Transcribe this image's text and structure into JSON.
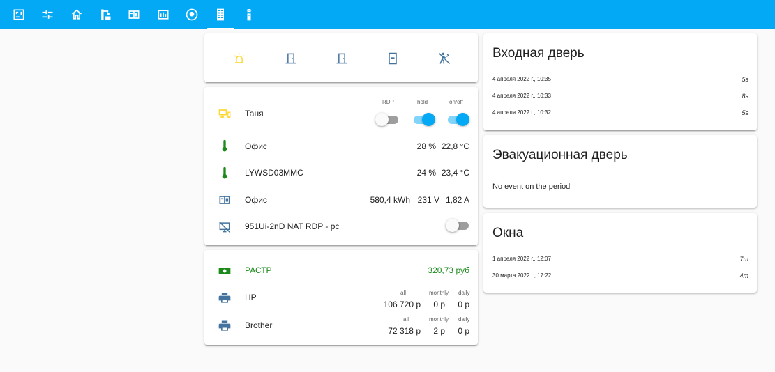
{
  "topbar": {
    "tabs": [
      {
        "icon": "floorplan-icon"
      },
      {
        "icon": "sliders-icon"
      },
      {
        "icon": "home-icon"
      },
      {
        "icon": "crane-icon"
      },
      {
        "icon": "meter-icon"
      },
      {
        "icon": "dashboard-icon"
      },
      {
        "icon": "robot-vacuum-icon"
      },
      {
        "icon": "office-building-icon"
      },
      {
        "icon": "remote-icon"
      }
    ],
    "active_tab": 7
  },
  "colors": {
    "accent": "#03a9f4",
    "icon_blue": "#44739e",
    "warning_yellow": "#fdd835",
    "green": "#1b8a1b",
    "text": "#212121"
  },
  "quick_icons": [
    {
      "icon": "alarm-light-icon",
      "color": "#fdd835"
    },
    {
      "icon": "door-icon",
      "color": "#44739e"
    },
    {
      "icon": "door-icon",
      "color": "#44739e"
    },
    {
      "icon": "door-sensor-icon",
      "color": "#44739e"
    },
    {
      "icon": "motion-sensor-icon",
      "color": "#44739e"
    }
  ],
  "office": {
    "switch_headers": {
      "rdp": "RDP",
      "hold": "hold",
      "onoff": "on/off"
    },
    "tanya": {
      "name": "Таня",
      "icon": "monitor-cellphone-icon",
      "rdp": false,
      "hold": true,
      "onoff": true
    },
    "office_temp": {
      "name": "Офис",
      "icon": "thermometer-icon",
      "humidity": "28 %",
      "temperature": "22,8 °C"
    },
    "lywsd": {
      "name": "LYWSD03MMC",
      "icon": "thermometer-icon",
      "humidity": "24 %",
      "temperature": "23,4 °C"
    },
    "office_power": {
      "name": "Офис",
      "icon": "meter-icon",
      "energy": "580,4 kWh",
      "voltage": "231 V",
      "current": "1,82 A"
    },
    "nat": {
      "name": "951Ui-2nD NAT RDP - pc",
      "icon": "monitor-off-icon",
      "on": false
    }
  },
  "billing": {
    "rastr": {
      "name": "РАСТР",
      "icon": "cash-icon",
      "value": "320,73 руб"
    },
    "col_headers": {
      "all": "all",
      "monthly": "monthly",
      "daily": "daily"
    },
    "printers": [
      {
        "name": "HP",
        "icon": "printer-icon",
        "all": "106 720 р",
        "monthly": "0 р",
        "daily": "0 р"
      },
      {
        "name": "Brother",
        "icon": "printer-icon",
        "all": "72 318 р",
        "monthly": "2 р",
        "daily": "0 р"
      }
    ]
  },
  "front_door": {
    "title": "Входная дверь",
    "events": [
      {
        "date": "4 апреля 2022 г., 10:35",
        "duration": "5s"
      },
      {
        "date": "4 апреля 2022 г., 10:33",
        "duration": "8s"
      },
      {
        "date": "4 апреля 2022 г., 10:32",
        "duration": "5s"
      }
    ]
  },
  "evac_door": {
    "title": "Эвакуационная дверь",
    "message": "No event on the period"
  },
  "windows": {
    "title": "Окна",
    "events": [
      {
        "date": "1 апреля 2022 г., 12:07",
        "duration": "7m"
      },
      {
        "date": "30 марта 2022 г., 17:22",
        "duration": "4m"
      }
    ]
  }
}
